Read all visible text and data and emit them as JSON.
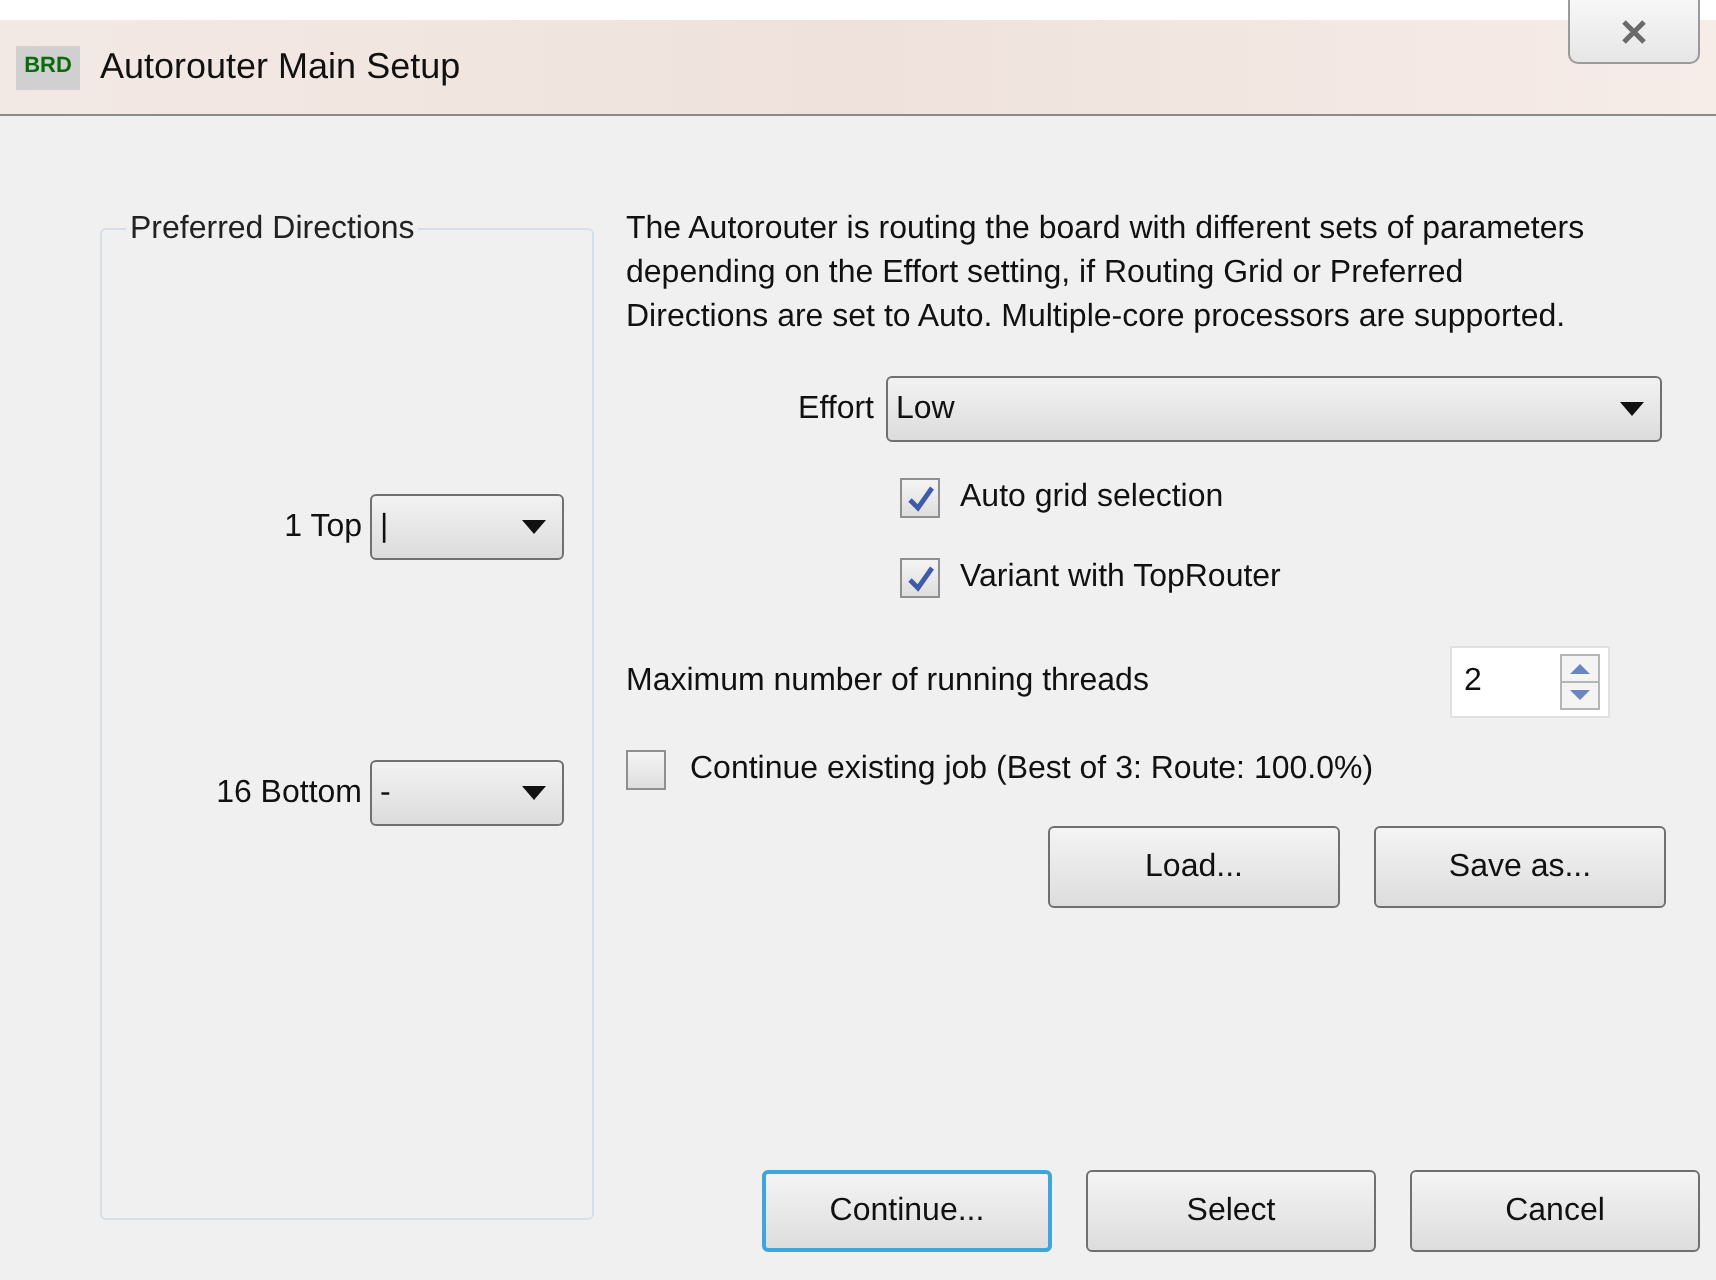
{
  "window": {
    "title": "Autorouter Main Setup",
    "icon_text": "BRD"
  },
  "preferred_directions": {
    "title": "Preferred Directions",
    "layers": [
      {
        "label": "1 Top",
        "value": "|"
      },
      {
        "label": "16 Bottom",
        "value": "-"
      }
    ]
  },
  "description": "The Autorouter is routing the board with different sets of parameters depending on the Effort setting, if Routing Grid or Preferred Directions are set to Auto. Multiple-core processors are supported.",
  "effort": {
    "label": "Effort",
    "value": "Low"
  },
  "options": [
    {
      "label": "Auto grid selection",
      "checked": true
    },
    {
      "label": "Variant with TopRouter",
      "checked": true
    }
  ],
  "threads": {
    "label": "Maximum number of running threads",
    "value": "2"
  },
  "continue_job": {
    "label": "Continue existing job (Best of 3: Route: 100.0%)",
    "checked": false
  },
  "file_buttons": [
    {
      "label": "Load...",
      "default": false
    },
    {
      "label": "Save as...",
      "default": false
    }
  ],
  "buttons": [
    {
      "label": "Continue...",
      "default": true
    },
    {
      "label": "Select",
      "default": false
    },
    {
      "label": "Cancel",
      "default": false
    }
  ]
}
